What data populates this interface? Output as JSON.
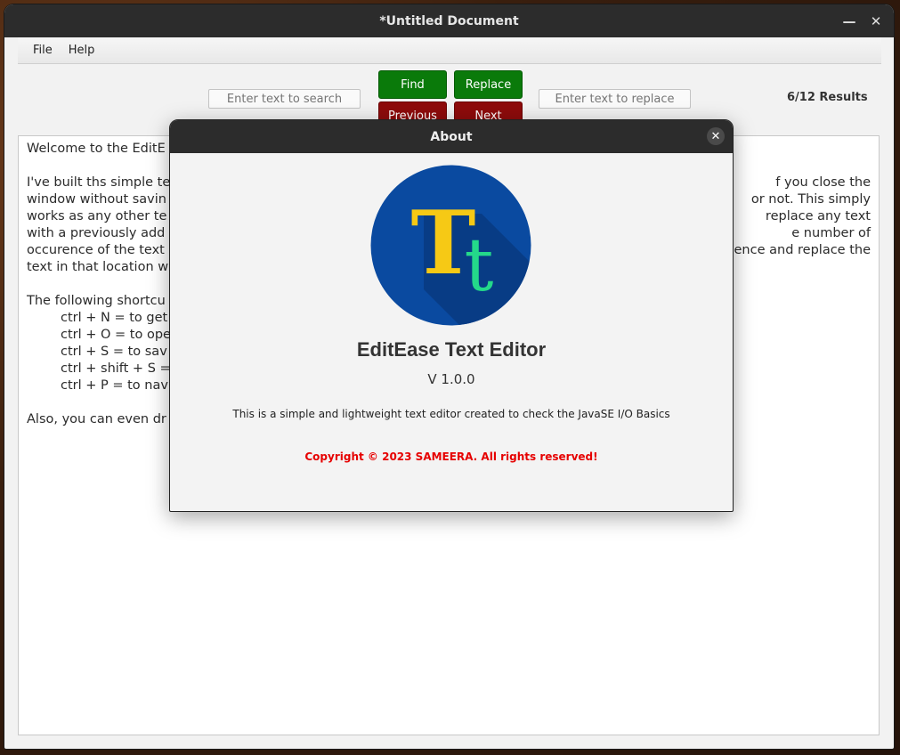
{
  "window": {
    "title": "*Untitled Document"
  },
  "window_controls": {
    "minimize": "—",
    "close": "✕"
  },
  "menu": {
    "file": "File",
    "help": "Help"
  },
  "toolbar": {
    "search_placeholder": "Enter text to search",
    "replace_placeholder": "Enter text to replace",
    "find": "Find",
    "replace": "Replace",
    "previous": "Previous",
    "next": "Next",
    "results": "6/12 Results"
  },
  "editor": {
    "lines": [
      {
        "text": "Welcome to the EditE",
        "indent": false
      },
      {
        "text": "",
        "indent": false
      },
      {
        "text": "I've built ths simple te",
        "indent": false,
        "right": "f you close the"
      },
      {
        "text": "window without savin",
        "indent": false,
        "right": "or not. This simply"
      },
      {
        "text": "works as any other te",
        "indent": false,
        "right": "replace any text"
      },
      {
        "text": "with a previously add",
        "indent": false,
        "right": "e number of"
      },
      {
        "text": "occurence of the text",
        "indent": false,
        "right": "ence and replace the"
      },
      {
        "text": "text in that location w",
        "indent": false
      },
      {
        "text": "",
        "indent": false
      },
      {
        "text": "The following shortcu",
        "indent": false
      },
      {
        "text": "ctrl + N = to get",
        "indent": true
      },
      {
        "text": "ctrl + O = to ope",
        "indent": true
      },
      {
        "text": "ctrl + S = to sav",
        "indent": true
      },
      {
        "text": "ctrl + shift + S =",
        "indent": true
      },
      {
        "text": "ctrl + P = to nav",
        "indent": true
      },
      {
        "text": "",
        "indent": false
      },
      {
        "text": "Also, you can even dr",
        "indent": false
      }
    ]
  },
  "about": {
    "title": "About",
    "close": "✕",
    "logo_letters": {
      "big": "T",
      "small": "t"
    },
    "app_name": "EditEase Text Editor",
    "version": "V 1.0.0",
    "description": "This is a simple and lightweight text editor created to check the JavaSE I/O Basics",
    "copyright": "Copyright © 2023 SAMEERA. All rights reserved!"
  },
  "colors": {
    "find_green": "#0a7a0a",
    "nav_red": "#8e0b0b",
    "logo_blue": "#0a4aa0",
    "logo_yellow": "#f6c915",
    "logo_green": "#24d98a",
    "copyright_red": "#e60000"
  }
}
